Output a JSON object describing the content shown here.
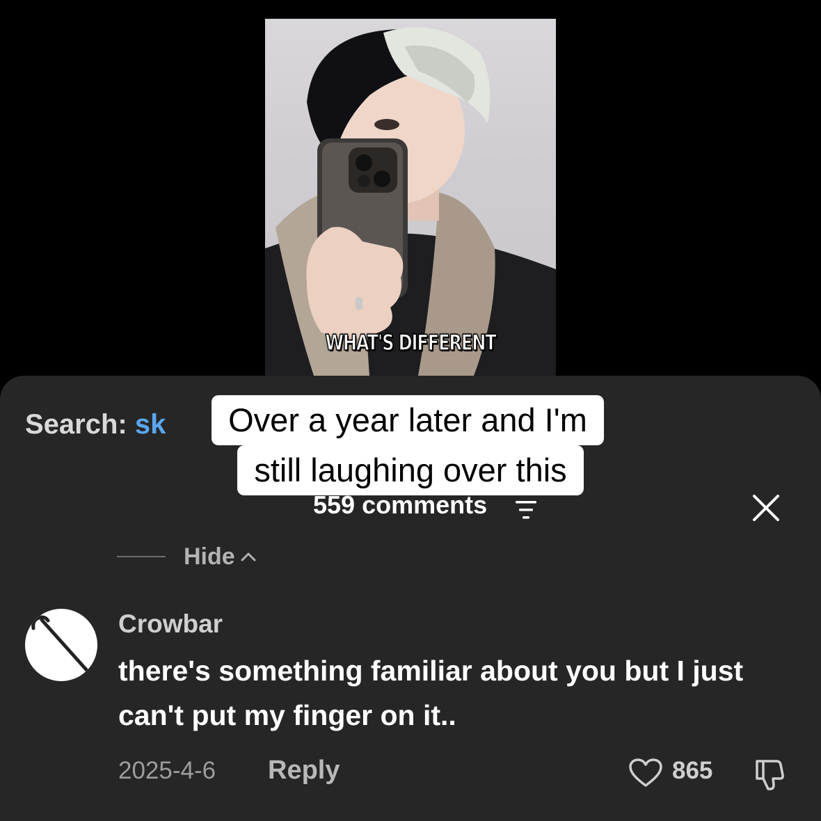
{
  "video": {
    "caption": "WHAT'S DIFFERENT"
  },
  "overlay": {
    "line1": "Over a year later and I'm",
    "line2": "still laughing over this"
  },
  "search": {
    "label": "Search:",
    "term": "sk"
  },
  "comments": {
    "count_label": "559 comments",
    "hide_label": "Hide",
    "items": [
      {
        "username": "Crowbar",
        "text": "there's something familiar about you but I just can't put my finger on it..",
        "date": "2025-4-6",
        "reply_label": "Reply",
        "likes": "865"
      }
    ]
  },
  "icons": {
    "filter": "filter-icon",
    "close": "close-icon",
    "chevron": "chevron-up-icon",
    "heart": "heart-icon",
    "dislike": "thumbs-down-icon",
    "avatar": "crowbar-avatar"
  },
  "colors": {
    "sheet_bg": "#262626",
    "search_term": "#5aa7f0",
    "overlay_bg": "#ffffff"
  }
}
